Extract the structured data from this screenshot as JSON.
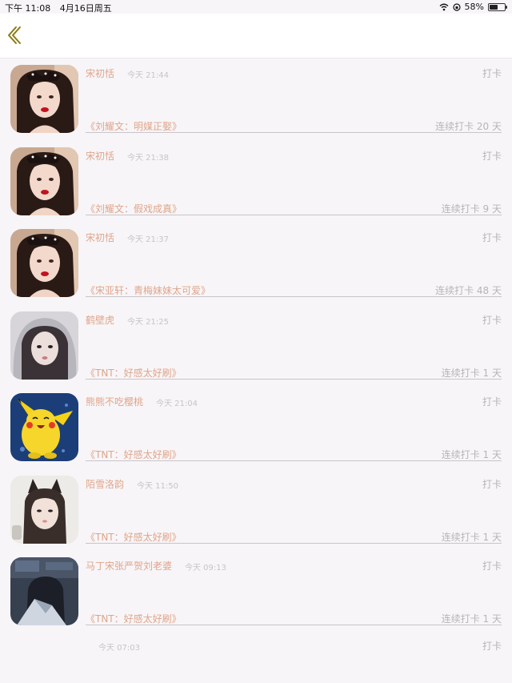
{
  "status_bar": {
    "time": "下午 11:08",
    "date": "4月16日周五",
    "battery_percent": "58%",
    "battery_level": 0.58,
    "icons": [
      "wifi-icon",
      "orientation-lock-icon",
      "battery-icon"
    ]
  },
  "nav": {
    "back_icon": "chevron-left-icon",
    "accent": "#8c7a12"
  },
  "colors": {
    "name": "#e0a58a",
    "meta": "#c9c3c7",
    "divider": "#c9c5ca",
    "background": "#f7f5f8"
  },
  "posts": [
    {
      "username": "宋初恬",
      "time": "今天 21:44",
      "action": "打卡",
      "book": "《刘耀文：明媒正娶》",
      "streak": "连续打卡 20 天",
      "avatar": "girl-with-bow"
    },
    {
      "username": "宋初恬",
      "time": "今天 21:38",
      "action": "打卡",
      "book": "《刘耀文：假戏成真》",
      "streak": "连续打卡 9 天",
      "avatar": "girl-with-bow"
    },
    {
      "username": "宋初恬",
      "time": "今天 21:37",
      "action": "打卡",
      "book": "《宋亚轩：青梅妹妹太可爱》",
      "streak": "连续打卡 48 天",
      "avatar": "girl-with-bow"
    },
    {
      "username": "鹤壁虎",
      "time": "今天 21:25",
      "action": "打卡",
      "book": "《TNT：好感太好刷》",
      "streak": "连续打卡 1 天",
      "avatar": "girl-in-hood"
    },
    {
      "username": "熊熊不吃樱桃",
      "time": "今天 21:04",
      "action": "打卡",
      "book": "《TNT：好感太好刷》",
      "streak": "连续打卡 1 天",
      "avatar": "pikachu"
    },
    {
      "username": "陌雪洛韵",
      "time": "今天 11:50",
      "action": "打卡",
      "book": "《TNT：好感太好刷》",
      "streak": "连续打卡 1 天",
      "avatar": "cat-ear-girl"
    },
    {
      "username": "马丁宋张严贺刘老婆",
      "time": "今天 09:13",
      "action": "打卡",
      "book": "《TNT：好感太好刷》",
      "streak": "连续打卡 1 天",
      "avatar": "dark-scene"
    }
  ],
  "partial_post": {
    "time": "今天 07:03",
    "action": "打卡"
  }
}
